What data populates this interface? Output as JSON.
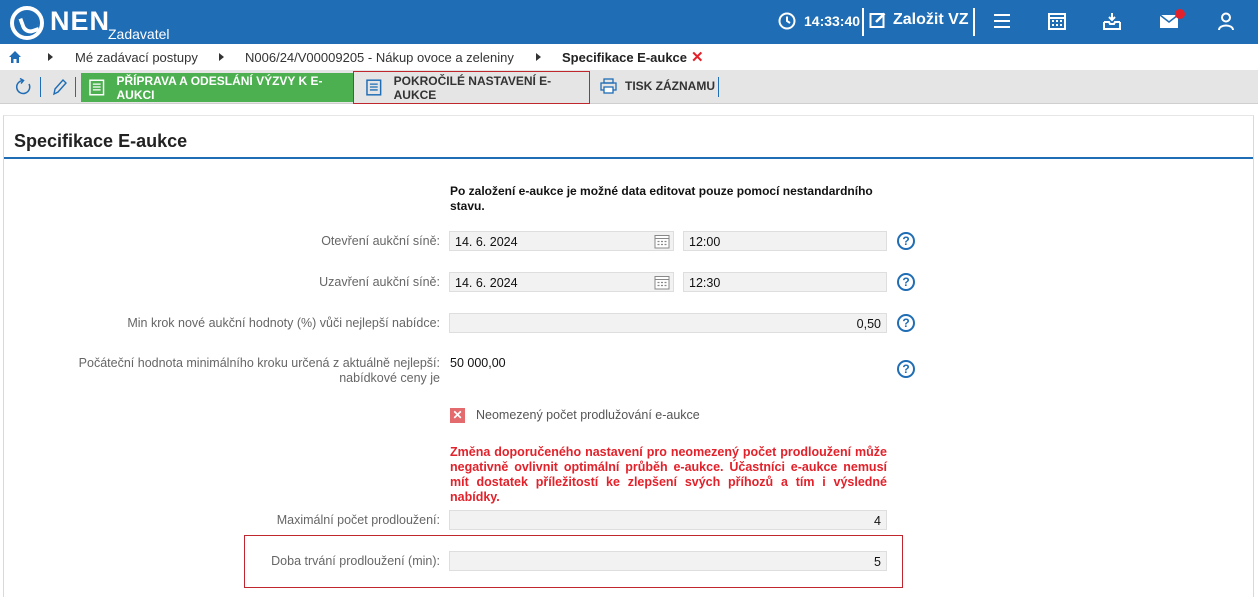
{
  "header": {
    "logo_text": "NEN",
    "logo_sub": "Zadavatel",
    "time": "14:33:40",
    "create_label": "Založit VZ",
    "icons": [
      "menu-icon",
      "calendar-icon",
      "inbox-icon",
      "mail-icon",
      "user-icon"
    ]
  },
  "breadcrumb": {
    "items": [
      "Mé zadávací postupy",
      "N006/24/V00009205 - Nákup ovoce a zeleniny"
    ],
    "current": "Specifikace E-aukce",
    "close": "✕"
  },
  "toolbar": {
    "prepare_label": "PŘÍPRAVA A ODESLÁNÍ VÝZVY K E-AUKCI",
    "advanced_label": "POKROČILÉ NASTAVENÍ E-AUKCE",
    "print_label": "TISK ZÁZNAMU"
  },
  "section": {
    "title": "Specifikace E-aukce"
  },
  "form": {
    "notice": "Po založení e-aukce je možné data editovat pouze pomocí nestandardního stavu.",
    "open_label": "Otevření aukční síně:",
    "open_date": "14. 6. 2024",
    "open_time": "12:00",
    "close_label": "Uzavření aukční síně:",
    "close_date": "14. 6. 2024",
    "close_time": "12:30",
    "min_step_label": "Min krok nové aukční hodnoty (%) vůči nejlepší nabídce:",
    "min_step_value": "0,50",
    "initial_label_1": "Počáteční hodnota minimálního kroku určená z aktuálně nejlepší:",
    "initial_label_2": "nabídkové ceny je",
    "initial_value": "50 000,00",
    "unlimited_label": "Neomezený počet prodlužování e-aukce",
    "unlimited_mark": "✕",
    "warning": "Změna doporučeného nastavení pro neomezený počet prodloužení může negativně ovlivnit optimální průběh e-aukce. Účastníci e-aukce nemusí mít dostatek příležitostí ke zlepšení svých příhozů a tím i výsledné nabídky.",
    "max_ext_label": "Maximální počet prodloužení:",
    "max_ext_value": "4",
    "duration_label": "Doba trvání prodloužení (min):",
    "duration_value": "5",
    "help": "?"
  },
  "colors": {
    "brand": "#1f6db5",
    "green": "#4caf50",
    "warning": "#e3212a"
  }
}
